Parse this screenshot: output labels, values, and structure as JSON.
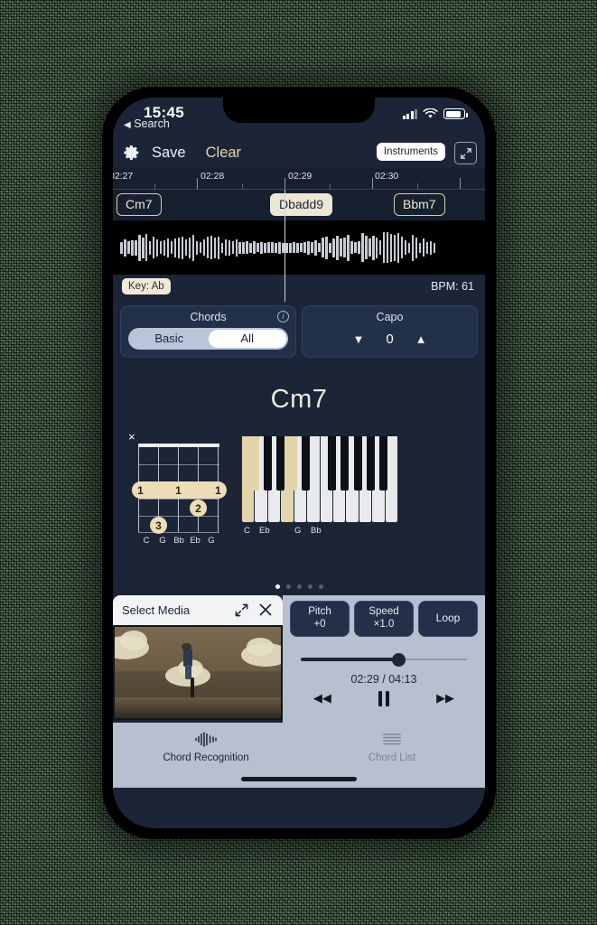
{
  "status_bar": {
    "time": "15:45",
    "back_label": "Search",
    "icons": [
      "signal-bars",
      "wifi",
      "battery"
    ]
  },
  "toolbar": {
    "gear_icon": "gear-icon",
    "save_label": "Save",
    "clear_label": "Clear",
    "instruments_label": "Instruments",
    "expand_icon": "expand-diagonal-icon"
  },
  "timeline": {
    "time_labels": [
      "02:27",
      "02:28",
      "02:29",
      "02:30"
    ],
    "chips": [
      {
        "label": "Cm7",
        "active": false
      },
      {
        "label": "Dbadd9",
        "active": true
      },
      {
        "label": "Bbm7",
        "active": false
      }
    ]
  },
  "analysis": {
    "key_label": "Key: Ab",
    "bpm_label": "BPM: 61"
  },
  "chords_card": {
    "title": "Chords",
    "info_icon": "info-icon",
    "segments": [
      {
        "label": "Basic",
        "selected": false
      },
      {
        "label": "All",
        "selected": true
      }
    ]
  },
  "capo_card": {
    "title": "Capo",
    "down_arrow": "▼",
    "value": "0",
    "up_arrow": "▲"
  },
  "chord_display": {
    "name": "Cm7",
    "guitar": {
      "muted_marker": "×",
      "string_notes": [
        "C",
        "G",
        "Bb",
        "Eb",
        "G"
      ],
      "fingers": [
        {
          "finger": "1",
          "type": "barre"
        },
        {
          "finger": "2",
          "type": "dot"
        },
        {
          "finger": "3",
          "type": "dot"
        }
      ]
    },
    "piano": {
      "note_labels": [
        "C",
        "Eb",
        "G",
        "Bb"
      ]
    },
    "page_dots": {
      "count": 5,
      "active_index": 0
    }
  },
  "media_panel": {
    "title": "Select Media",
    "expand_icon": "expand-icon",
    "close_icon": "close-icon"
  },
  "player": {
    "pitch_label": "Pitch",
    "pitch_value": "+0",
    "speed_label": "Speed",
    "speed_value": "×1.0",
    "loop_label": "Loop",
    "time_display": "02:29 / 04:13",
    "progress_percent": 59,
    "rewind_icon": "rewind-icon",
    "pause_icon": "pause-icon",
    "forward_icon": "fast-forward-icon"
  },
  "tab_bar": {
    "tabs": [
      {
        "label": "Chord Recognition",
        "icon": "waveform-icon",
        "active": true
      },
      {
        "label": "Chord List",
        "icon": "list-icon",
        "active": false
      }
    ]
  },
  "colors": {
    "app_background": "#1b2537",
    "accent_cream": "#ecddb6",
    "panel_light": "#b6c0ce",
    "backdrop_green": "#57765a"
  }
}
